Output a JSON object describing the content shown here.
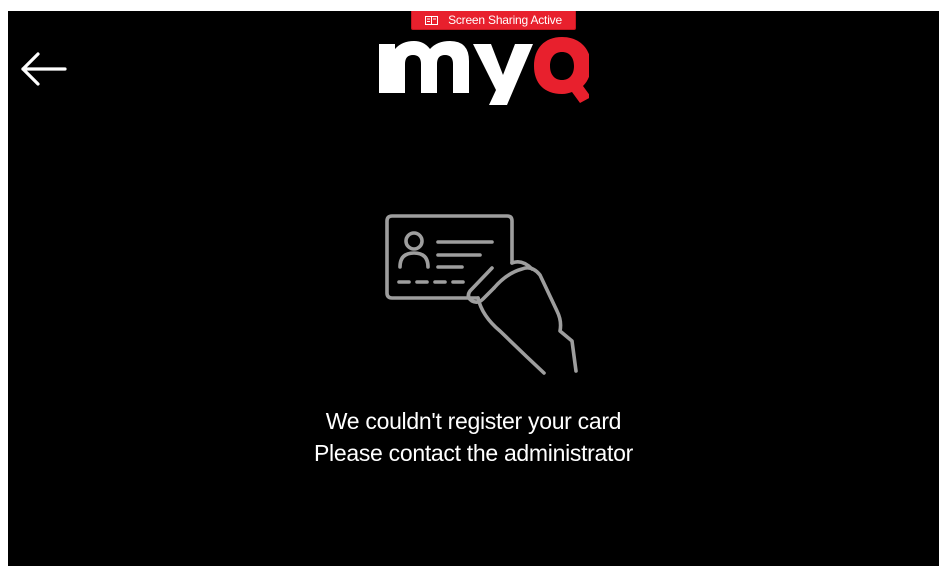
{
  "status_banner": {
    "text": "Screen Sharing Active",
    "icon": "screen-share-icon",
    "color": "#e8202d"
  },
  "header": {
    "back_icon": "arrow-left-icon",
    "logo": {
      "text": "myQ",
      "white_part": "my",
      "accent_part": "Q",
      "accent_color": "#e8202d"
    }
  },
  "main": {
    "illustration_icon": "hand-holding-id-card-icon",
    "message_line1": "We couldn't register your card",
    "message_line2": "Please contact the administrator"
  },
  "colors": {
    "background": "#000000",
    "text": "#ffffff",
    "illustration": "#9e9e9e"
  }
}
